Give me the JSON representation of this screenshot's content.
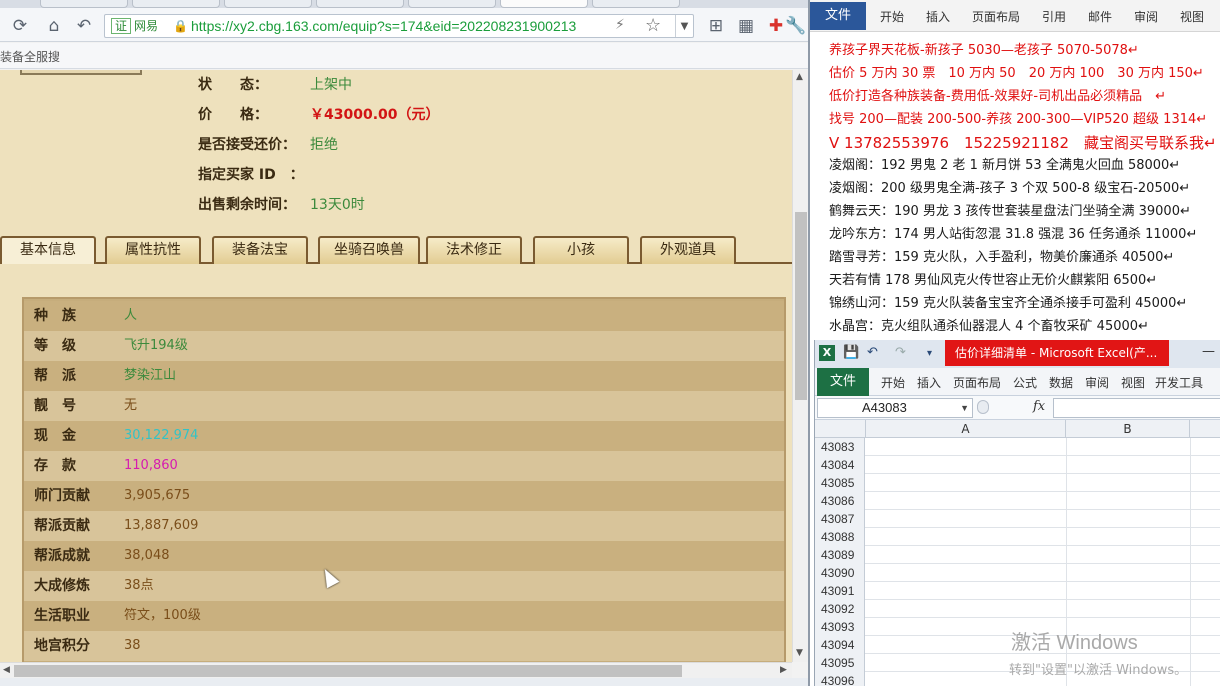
{
  "browser": {
    "address": {
      "cert_label": "证",
      "site_label": "网易",
      "url": "https://xy2.cbg.163.com/equip?s=174&eid=202208231900213"
    },
    "bookmark_text": "装备全服搜",
    "sale_info": [
      {
        "label": "状　　态：",
        "value": "上架中",
        "tone": "green"
      },
      {
        "label": "价　　格：",
        "value": "￥43000.00（元）",
        "tone": "red"
      },
      {
        "label": "是否接受还价：",
        "value": "拒绝",
        "tone": "green"
      },
      {
        "label": "指定买家 ID　：",
        "value": "",
        "tone": "green"
      },
      {
        "label": "出售剩余时间：",
        "value": "13天0时",
        "tone": "green"
      }
    ],
    "tabs": [
      "基本信息",
      "属性抗性",
      "装备法宝",
      "坐骑召唤兽",
      "法术修正",
      "小孩",
      "外观道具"
    ],
    "active_tab": "基本信息",
    "attributes": [
      {
        "key": "种　族",
        "value": "人",
        "tone": "green"
      },
      {
        "key": "等　级",
        "value": "飞升194级",
        "tone": "green"
      },
      {
        "key": "帮　派",
        "value": "梦染江山",
        "tone": "green"
      },
      {
        "key": "靓　号",
        "value": "无",
        "tone": "brown"
      },
      {
        "key": "现　金",
        "value": "30,122,974",
        "tone": "cyan"
      },
      {
        "key": "存　款",
        "value": "110,860",
        "tone": "mag"
      },
      {
        "key": "师门贡献",
        "value": "3,905,675",
        "tone": "brown"
      },
      {
        "key": "帮派贡献",
        "value": "13,887,609",
        "tone": "brown"
      },
      {
        "key": "帮派成就",
        "value": "38,048",
        "tone": "brown"
      },
      {
        "key": "大成修炼",
        "value": "38点",
        "tone": "brown"
      },
      {
        "key": "生活职业",
        "value": "符文，100级",
        "tone": "brown"
      },
      {
        "key": "地宫积分",
        "value": "38",
        "tone": "brown"
      }
    ]
  },
  "word": {
    "ribbon": [
      "文件",
      "开始",
      "插入",
      "页面布局",
      "引用",
      "邮件",
      "审阅",
      "视图"
    ],
    "lines": [
      {
        "text": "养孩子界天花板-新孩子 5030—老孩子 5070-5078↵",
        "tone": "r"
      },
      {
        "text": "估价 5 万内 30 票　10 万内 50　20 万内 100　30 万内 150↵",
        "tone": "r"
      },
      {
        "text": "低价打造各种族装备-费用低-效果好-司机出品必须精品　↵",
        "tone": "r"
      },
      {
        "text": "找号 200—配装 200-500-养孩 200-300—VIP520 超级 1314↵",
        "tone": "r"
      },
      {
        "text": "V 13782553976　15225921182　藏宝阁买号联系我↵",
        "tone": "r",
        "big": true
      },
      {
        "text": "凌烟阁：192 男鬼 2 老 1 新月饼 53 全满鬼火回血 58000↵",
        "tone": "k"
      },
      {
        "text": "凌烟阁：200 级男鬼全满-孩子 3 个双 500-8 级宝石-20500↵",
        "tone": "k"
      },
      {
        "text": "鹤舞云天：190 男龙 3 孩传世套装星盘法门坐骑全满 39000↵",
        "tone": "k"
      },
      {
        "text": "龙吟东方：174 男人站街忽混 31.8 强混 36 任务通杀 11000↵",
        "tone": "k"
      },
      {
        "text": "踏雪寻芳：159 克火队，入手盈利，物美价廉通杀 40500↵",
        "tone": "k"
      },
      {
        "text": "天若有情 178 男仙风克火传世容止无价火麒紫阳 6500↵",
        "tone": "k"
      },
      {
        "text": "锦绣山河：159 克火队装备宝宝齐全通杀接手可盈利 45000↵",
        "tone": "k"
      },
      {
        "text": "水晶宫：克火组队通杀仙器混人 4 个畜牧采矿 45000↵",
        "tone": "k"
      }
    ]
  },
  "excel": {
    "logo": "X",
    "title": "估价详细清单 - Microsoft Excel(产...",
    "ribbon": [
      "文件",
      "开始",
      "插入",
      "页面布局",
      "公式",
      "数据",
      "审阅",
      "视图",
      "开发工具"
    ],
    "name_box": "A43083",
    "fx_label": "fx",
    "columns": [
      "A",
      "B"
    ],
    "rows": [
      "43083",
      "43084",
      "43085",
      "43086",
      "43087",
      "43088",
      "43089",
      "43090",
      "43091",
      "43092",
      "43093",
      "43094",
      "43095",
      "43096"
    ],
    "watermark_title": "激活 Windows",
    "watermark_text": "转到\"设置\"以激活 Windows。"
  }
}
